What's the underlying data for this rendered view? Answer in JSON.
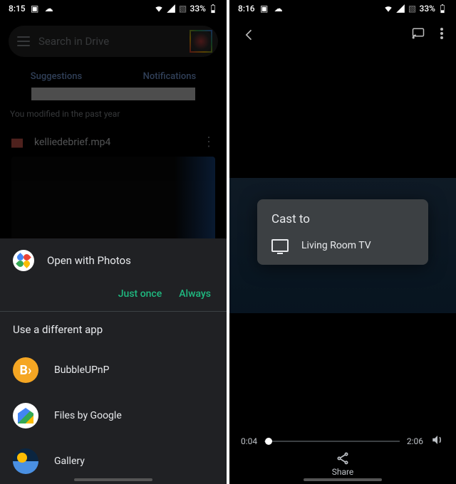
{
  "phone1": {
    "time": "8:15",
    "battery": "33%",
    "search_placeholder": "Search in Drive",
    "tabs": {
      "suggestions": "Suggestions",
      "notifications": "Notifications"
    },
    "modified": "You modified in the past year",
    "file_name": "kelliedebrief.mp4",
    "open_with": "Open with Photos",
    "just_once": "Just once",
    "always": "Always",
    "use_different": "Use a different app",
    "apps": [
      {
        "label": "BubbleUPnP"
      },
      {
        "label": "Files by Google"
      },
      {
        "label": "Gallery"
      }
    ]
  },
  "phone2": {
    "time": "8:16",
    "battery": "33%",
    "cast_title": "Cast to",
    "cast_device": "Living Room TV",
    "elapsed": "0:04",
    "duration": "2:06",
    "share_label": "Share"
  }
}
